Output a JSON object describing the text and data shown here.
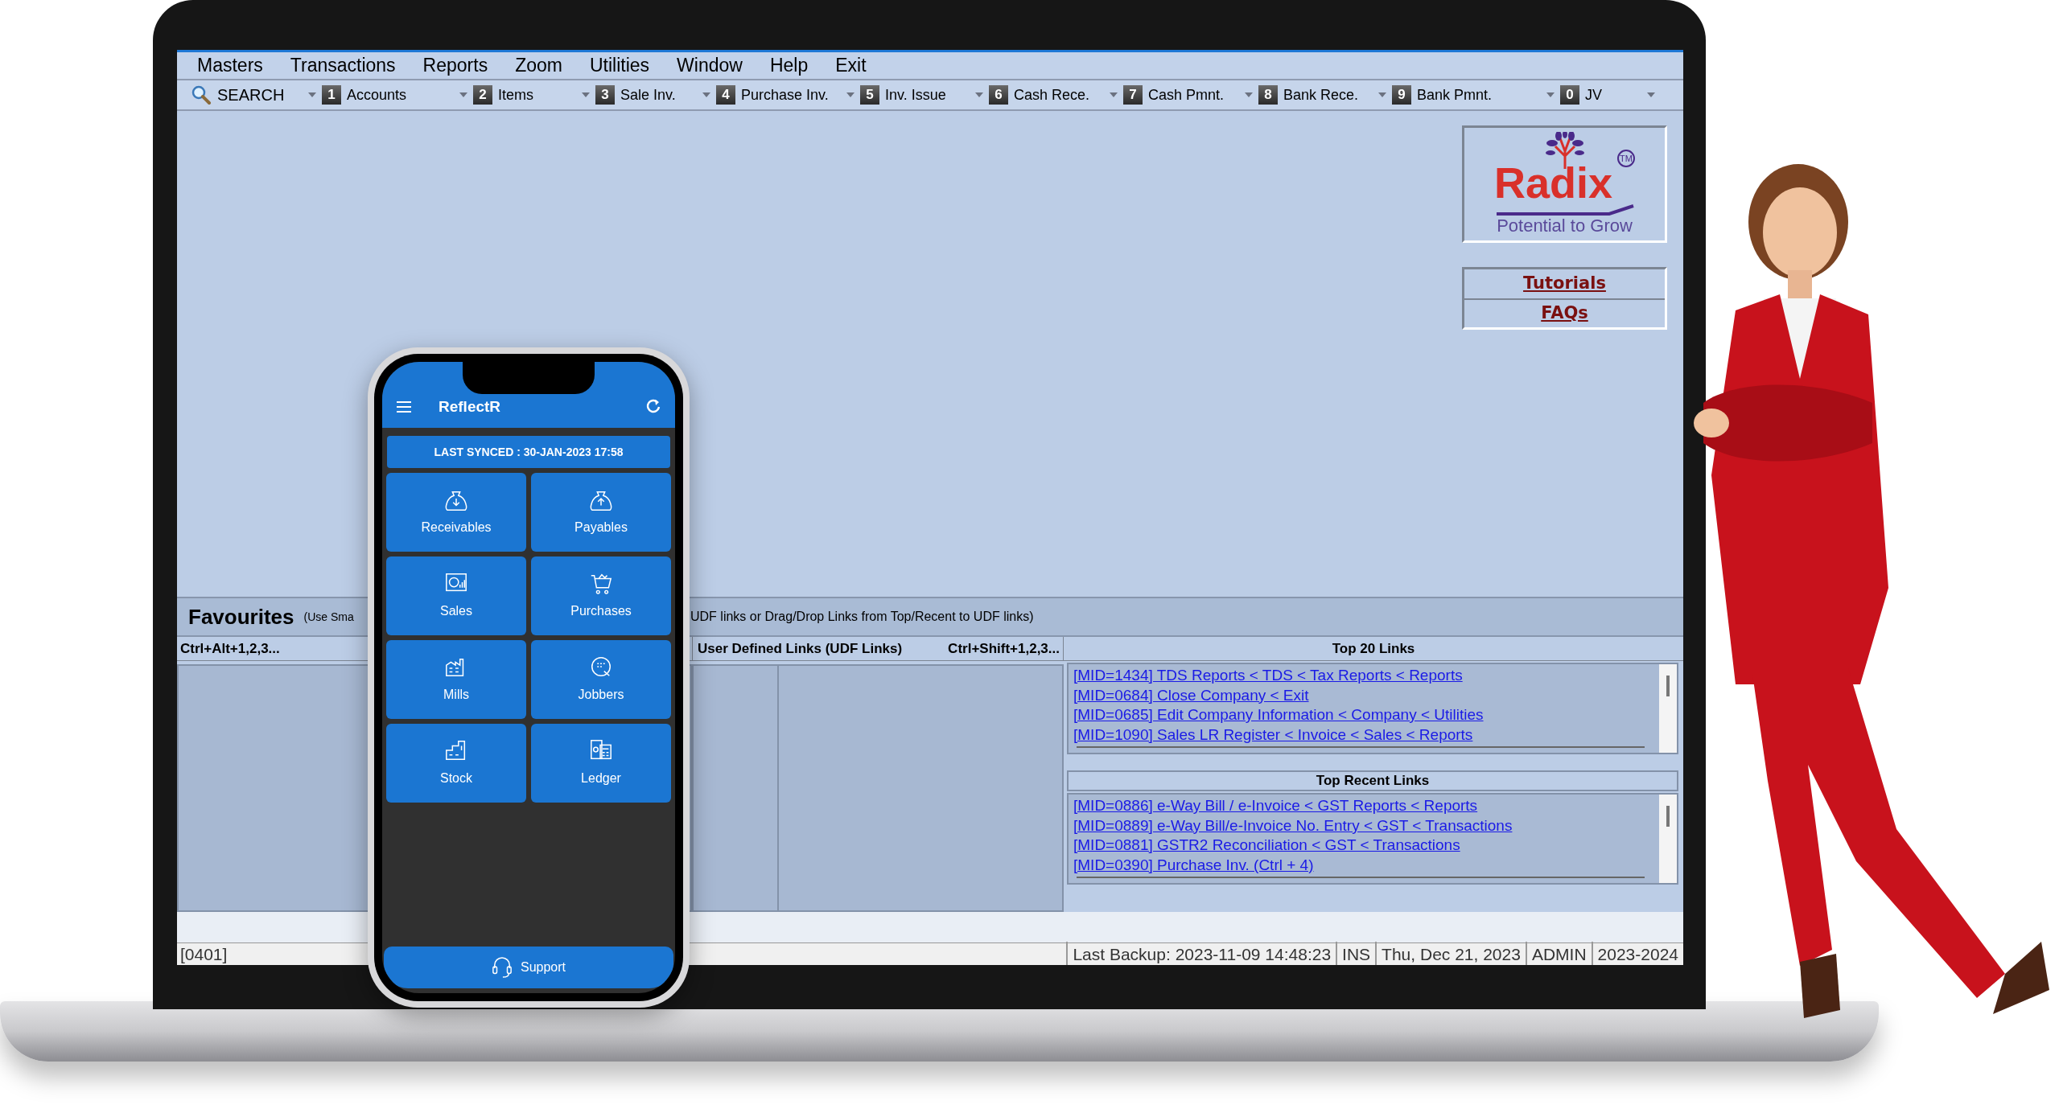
{
  "menu": [
    "Masters",
    "Transactions",
    "Reports",
    "Zoom",
    "Utilities",
    "Window",
    "Help",
    "Exit"
  ],
  "toolbar": [
    {
      "kind": "search",
      "label": "SEARCH"
    },
    {
      "kind": "shortcut",
      "key": "1",
      "label": "Accounts"
    },
    {
      "kind": "shortcut",
      "key": "2",
      "label": "Items"
    },
    {
      "kind": "shortcut",
      "key": "3",
      "label": "Sale Inv."
    },
    {
      "kind": "shortcut",
      "key": "4",
      "label": "Purchase Inv."
    },
    {
      "kind": "shortcut",
      "key": "5",
      "label": "Inv. Issue"
    },
    {
      "kind": "shortcut",
      "key": "6",
      "label": "Cash Rece."
    },
    {
      "kind": "shortcut",
      "key": "7",
      "label": "Cash Pmnt."
    },
    {
      "kind": "shortcut",
      "key": "8",
      "label": "Bank Rece."
    },
    {
      "kind": "shortcut",
      "key": "9",
      "label": "Bank Pmnt."
    },
    {
      "kind": "shortcut",
      "key": "0",
      "label": "JV"
    }
  ],
  "logo": {
    "name": "Radix",
    "trademark": "TM",
    "tagline": "Potential to Grow"
  },
  "help_links": [
    "Tutorials",
    "FAQs"
  ],
  "favourites": {
    "title": "Favourites",
    "hint_start": "(Use Sma",
    "hint_end": "UDF links or Drag/Drop Links from Top/Recent to UDF links)",
    "shortcut": "Ctrl+Alt+1,2,3...",
    "udf_title": "User Defined Links (UDF Links)",
    "udf_shortcut": "Ctrl+Shift+1,2,3..."
  },
  "top_links": {
    "title": "Top 20 Links",
    "items": [
      "[MID=1434] TDS Reports < TDS < Tax Reports < Reports",
      "[MID=0684] Close Company < Exit",
      "[MID=0685] Edit Company Information < Company < Utilities",
      "[MID=1090] Sales LR Register < Invoice < Sales < Reports"
    ]
  },
  "recent_links": {
    "title": "Top Recent Links",
    "items": [
      "[MID=0886] e-Way Bill / e-Invoice < GST Reports < Reports",
      "[MID=0889] e-Way Bill/e-Invoice No. Entry < GST < Transactions",
      "[MID=0881] GSTR2 Reconciliation < GST < Transactions",
      "[MID=0390] Purchase Inv. (Ctrl + 4)"
    ]
  },
  "status_bar": {
    "code": "[0401]",
    "fields": [
      "Last Backup: 2023-11-09 14:48:23",
      "INS",
      "Thu, Dec 21, 2023",
      "ADMIN",
      "2023-2024"
    ]
  },
  "phone": {
    "app_title": "ReflectR",
    "last_synced": "LAST SYNCED : 30-JAN-2023 17:58",
    "tiles": [
      {
        "label": "Receivables",
        "kind": "receivables"
      },
      {
        "label": "Payables",
        "kind": "payables"
      },
      {
        "label": "Sales",
        "kind": "sales"
      },
      {
        "label": "Purchases",
        "kind": "purchases"
      },
      {
        "label": "Mills",
        "kind": "mills"
      },
      {
        "label": "Jobbers",
        "kind": "jobbers"
      },
      {
        "label": "Stock",
        "kind": "stock"
      },
      {
        "label": "Ledger",
        "kind": "ledger"
      }
    ],
    "support": "Support"
  }
}
